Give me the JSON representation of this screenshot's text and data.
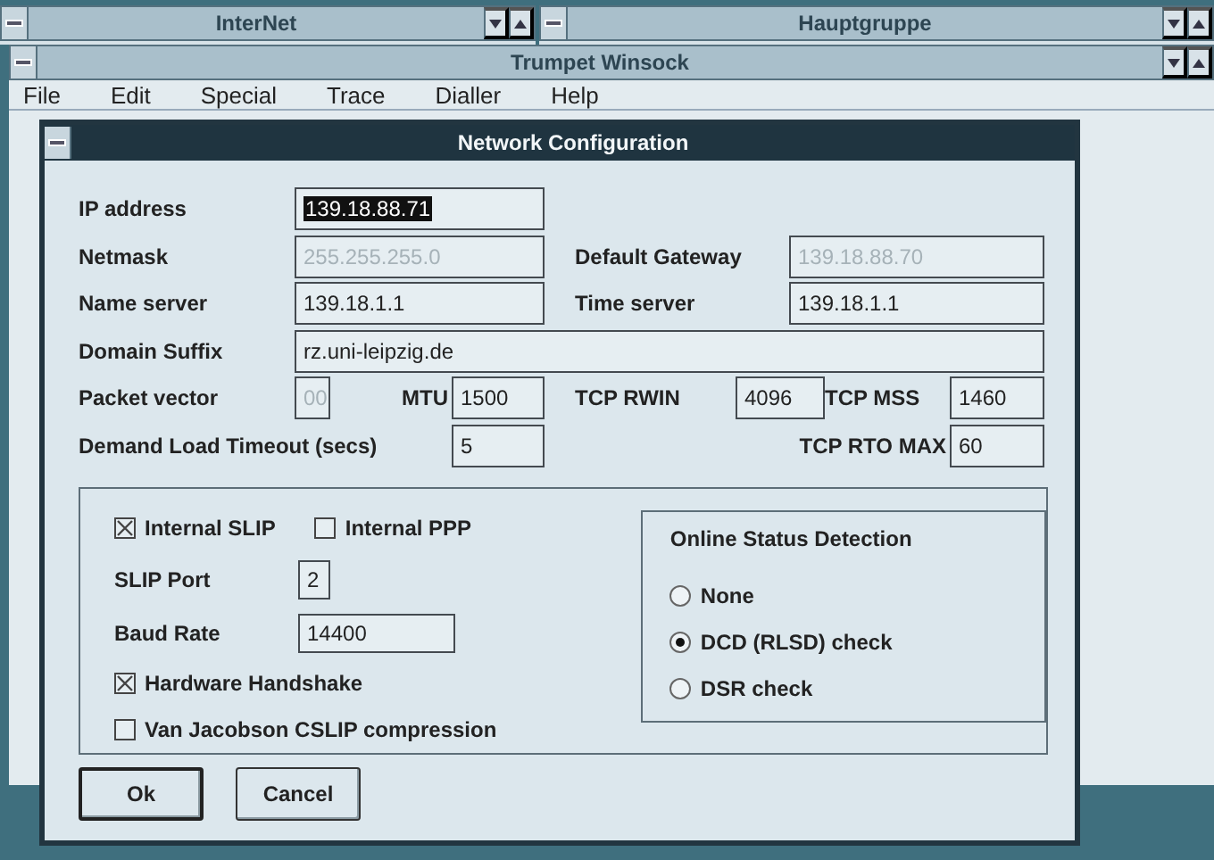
{
  "background_windows": [
    {
      "title": "InterNet"
    },
    {
      "title": "Hauptgruppe"
    }
  ],
  "main_window": {
    "title": "Trumpet Winsock",
    "menu": [
      "File",
      "Edit",
      "Special",
      "Trace",
      "Dialler",
      "Help"
    ]
  },
  "dialog": {
    "title": "Network Configuration",
    "rows": [
      [
        {
          "label": "IP address",
          "value": "139.18.88.71",
          "highlighted": true,
          "disabled": false
        }
      ],
      [
        {
          "label": "Netmask",
          "value": "255.255.255.0",
          "highlighted": false,
          "disabled": true
        },
        {
          "label": "Default Gateway",
          "value": "139.18.88.70",
          "highlighted": false,
          "disabled": true
        }
      ],
      [
        {
          "label": "Name server",
          "value": "139.18.1.1",
          "highlighted": false,
          "disabled": false
        },
        {
          "label": "Time server",
          "value": "139.18.1.1",
          "highlighted": false,
          "disabled": false
        }
      ],
      [
        {
          "label": "Domain Suffix",
          "value": "rz.uni-leipzig.de",
          "highlighted": false,
          "disabled": false
        }
      ],
      [
        {
          "label": "Packet vector",
          "value": "00",
          "highlighted": false,
          "disabled": true
        },
        {
          "label": "MTU",
          "value": "1500",
          "highlighted": false,
          "disabled": false
        },
        {
          "label": "TCP RWIN",
          "value": "4096",
          "highlighted": false,
          "disabled": false
        },
        {
          "label": "TCP MSS",
          "value": "1460",
          "highlighted": false,
          "disabled": false
        }
      ],
      [
        {
          "label": "Demand Load Timeout (secs)",
          "value": "5",
          "highlighted": false,
          "disabled": false
        },
        {
          "label": "TCP RTO MAX",
          "value": "60",
          "highlighted": false,
          "disabled": false
        }
      ]
    ],
    "protocols": [
      {
        "label": "Internal SLIP",
        "checked": true
      },
      {
        "label": "Internal PPP",
        "checked": false
      }
    ],
    "port_fields": [
      {
        "label": "SLIP Port",
        "value": "2"
      },
      {
        "label": "Baud Rate",
        "value": "14400"
      }
    ],
    "options": [
      {
        "label": "Hardware Handshake",
        "checked": true
      },
      {
        "label": "Van Jacobson CSLIP compression",
        "checked": false
      }
    ],
    "online_status": {
      "title": "Online Status Detection",
      "options": [
        {
          "label": "None",
          "selected": false
        },
        {
          "label": "DCD (RLSD) check",
          "selected": true
        },
        {
          "label": "DSR check",
          "selected": false
        }
      ]
    },
    "buttons": [
      {
        "label": "Ok",
        "default": true
      },
      {
        "label": "Cancel",
        "default": false
      }
    ]
  }
}
